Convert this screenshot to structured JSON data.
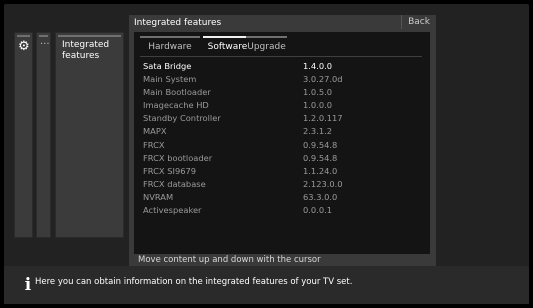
{
  "panel": {
    "title": "Integrated features",
    "back_label": "Back",
    "hint": "Move content up and down with the cursor"
  },
  "menu": {
    "dots_label": "···",
    "selected_label": "Integrated features",
    "icon": "gear-icon"
  },
  "tabs": [
    {
      "label": "Hardware",
      "active": false
    },
    {
      "label": "Software",
      "active": true
    },
    {
      "label": "Upgrade",
      "active": false
    }
  ],
  "features": [
    {
      "name": "Sata Bridge",
      "version": "1.4.0.0"
    },
    {
      "name": "Main System",
      "version": "3.0.27.0d"
    },
    {
      "name": "Main Bootloader",
      "version": "1.0.5.0"
    },
    {
      "name": "Imagecache HD",
      "version": "1.0.0.0"
    },
    {
      "name": "Standby Controller",
      "version": "1.2.0.117"
    },
    {
      "name": "MAPX",
      "version": "2.3.1.2"
    },
    {
      "name": "FRCX",
      "version": "0.9.54.8"
    },
    {
      "name": "FRCX bootloader",
      "version": "0.9.54.8"
    },
    {
      "name": "FRCX SI9679",
      "version": "1.1.24.0"
    },
    {
      "name": "FRCX database",
      "version": "2.123.0.0"
    },
    {
      "name": "NVRAM",
      "version": "63.3.0.0"
    },
    {
      "name": "Activespeaker",
      "version": "0.0.0.1"
    }
  ],
  "info": {
    "icon": "info-icon",
    "text": "Here you can obtain information on the integrated features of your TV set."
  },
  "colors": {
    "background": "#000000",
    "panel": "#3a3a3a",
    "inner": "#141414",
    "active_tab_bar": "#f0f0f0"
  }
}
